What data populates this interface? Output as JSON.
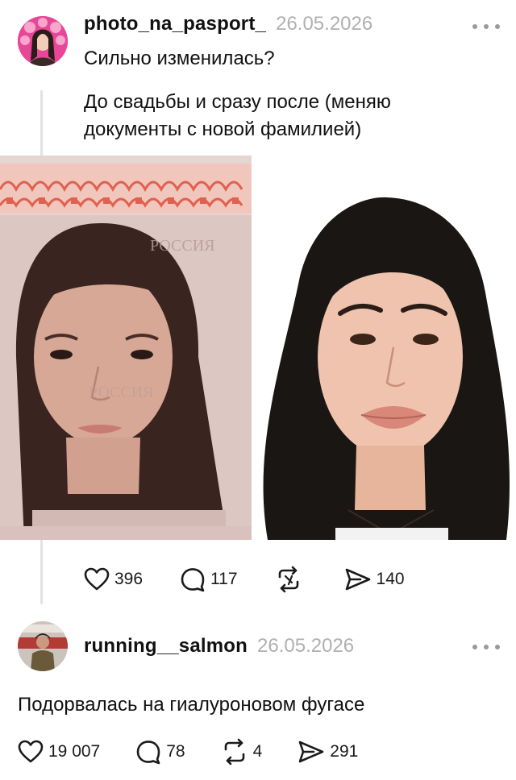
{
  "post": {
    "username": "photo_na_pasport_",
    "date": "26.05.2026",
    "title": "Сильно изменилась?",
    "body": "До свадьбы и сразу после (меняю документы с новой фамилией)",
    "photo_left": {
      "stamp_text": "РОССИЯ"
    },
    "stats": {
      "likes": "396",
      "comments": "117",
      "reposts": "",
      "shares": "140"
    }
  },
  "reply": {
    "username": "running__salmon",
    "date": "26.05.2026",
    "body": "Подорвалась на гиалуроновом фугасе",
    "stats": {
      "likes": "19 007",
      "comments": "78",
      "reposts": "4",
      "shares": "291"
    }
  },
  "icons": {
    "like": "heart-icon",
    "comment": "comment-bubble-icon",
    "repost": "repost-icon",
    "share": "send-icon",
    "more": "more-dots-icon"
  },
  "colors": {
    "accent_pink": "#e13b8f",
    "muted": "#b0b0b0",
    "text": "#111111"
  }
}
